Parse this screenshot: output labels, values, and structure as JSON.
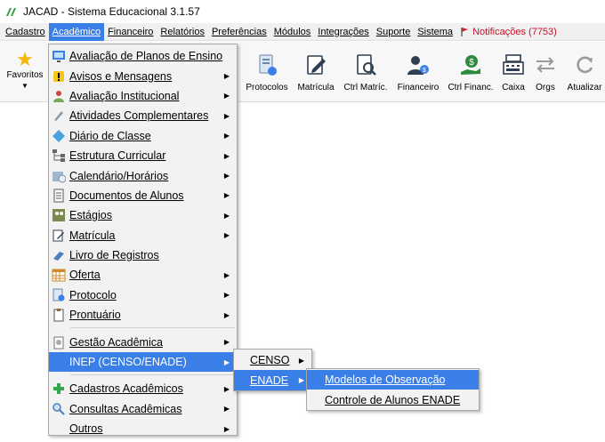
{
  "window": {
    "title": "JACAD - Sistema Educacional 3.1.57"
  },
  "menubar": {
    "items": [
      "Cadastro",
      "Acadêmico",
      "Financeiro",
      "Relatórios",
      "Preferências",
      "Módulos",
      "Integrações",
      "Suporte",
      "Sistema"
    ],
    "notifications": "Notificações (7753)"
  },
  "toolbar": {
    "favorites": "Favoritos",
    "buttons": [
      "Protocolos",
      "Matrícula",
      "Ctrl Matríc.",
      "Financeiro",
      "Ctrl Financ.",
      "Caixa",
      "Orgs",
      "Atualizar"
    ]
  },
  "academico_menu": {
    "items": [
      "Avaliação de Planos de Ensino",
      "Avisos e Mensagens",
      "Avaliação Institucional",
      "Atividades Complementares",
      "Diário de Classe",
      "Estrutura Curricular",
      "Calendário/Horários",
      "Documentos de Alunos",
      "Estágios",
      "Matrícula",
      "Livro de Registros",
      "Oferta",
      "Protocolo",
      "Prontuário",
      "Gestão Acadêmica",
      "INEP (CENSO/ENADE)",
      "Cadastros Acadêmicos",
      "Consultas Acadêmicas",
      "Outros"
    ]
  },
  "inep_menu": {
    "items": [
      "CENSO",
      "ENADE"
    ]
  },
  "enade_menu": {
    "items": [
      "Modelos de Observação",
      "Controle de Alunos ENADE"
    ]
  },
  "colors": {
    "highlight": "#3a7ee8",
    "notification": "#c0162b",
    "menu_bg": "#f2f2f2"
  }
}
